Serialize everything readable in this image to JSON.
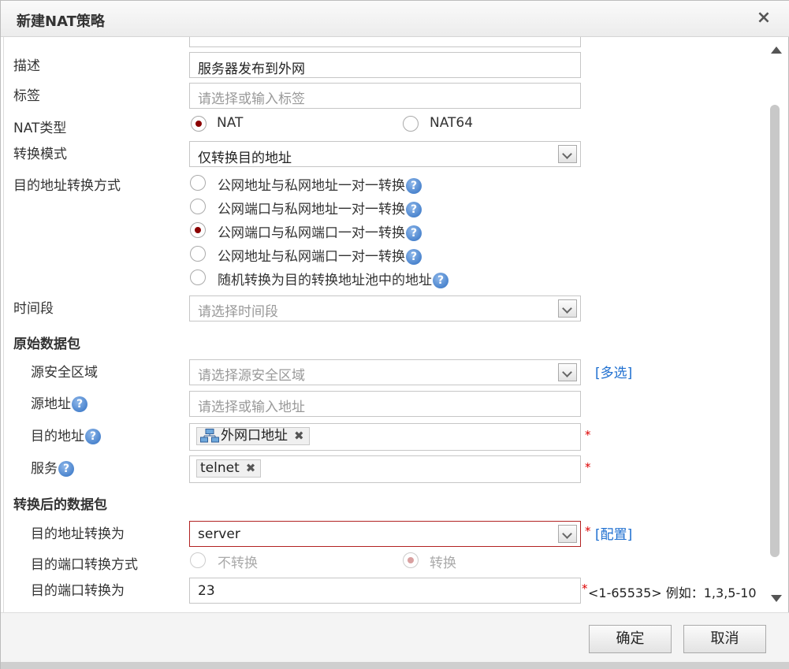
{
  "dialog": {
    "title": "新建NAT策略",
    "close": "×"
  },
  "labels": {
    "desc": "描述",
    "tag": "标签",
    "nat_type": "NAT类型",
    "mode": "转换模式",
    "dst_method": "目的地址转换方式",
    "time": "时间段",
    "src_zone": "源安全区域",
    "src_addr": "源地址",
    "dst_addr": "目的地址",
    "service": "服务",
    "dst_to": "目的地址转换为",
    "port_method": "目的端口转换方式",
    "port_to": "目的端口转换为"
  },
  "sections": {
    "original": "原始数据包",
    "translated": "转换后的数据包"
  },
  "fields": {
    "desc_value": "服务器发布到外网",
    "tag_placeholder": "请选择或输入标签",
    "mode_value": "仅转换目的地址",
    "time_placeholder": "请选择时间段",
    "src_zone_placeholder": "请选择源安全区域",
    "src_addr_placeholder": "请选择或输入地址",
    "dst_addr_tag": "外网口地址",
    "service_tag": "telnet",
    "dst_to_value": "server",
    "port_to_value": "23"
  },
  "nat_type": {
    "options": [
      "NAT",
      "NAT64"
    ],
    "selected": "NAT"
  },
  "dst_methods": {
    "options": [
      "公网地址与私网地址一对一转换",
      "公网端口与私网地址一对一转换",
      "公网端口与私网端口一对一转换",
      "公网地址与私网端口一对一转换",
      "随机转换为目的转换地址池中的地址"
    ],
    "selected_index": 2
  },
  "port_method": {
    "options": [
      "不转换",
      "转换"
    ],
    "selected": "转换"
  },
  "links": {
    "multi": "[多选]",
    "config": "[配置]"
  },
  "help_glyph": "?",
  "remove_glyph": "✖",
  "required": "*",
  "port_hint": "<1-65535> 例如：1,3,5-10",
  "buttons": {
    "ok": "确定",
    "cancel": "取消"
  },
  "colors": {
    "selected_radio": "#8b0000",
    "link": "#1e6fd0",
    "required": "#d00000",
    "error_border": "#b22222"
  }
}
